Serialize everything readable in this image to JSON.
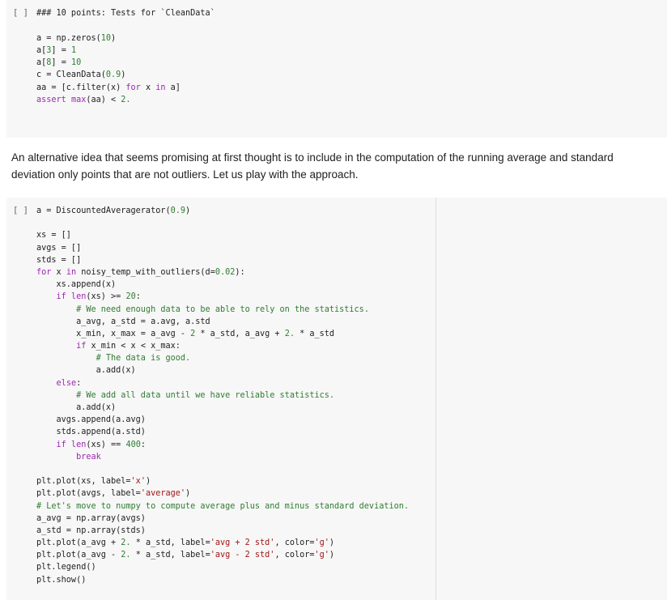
{
  "cell1": {
    "run_label": "[ ]",
    "lines": [
      "### 10 points: Tests for `CleanData`",
      "",
      "a = np.zeros(10)",
      "a[3] = 1",
      "a[8] = 10",
      "c = CleanData(0.9)",
      "aa = [c.filter(x) for x in a]",
      "assert max(aa) < 2."
    ]
  },
  "markdown": {
    "text": "An alternative idea that seems promising at first thought is to include in the computation of the running average and standard deviation only points that are not outliers. Let us play with the approach."
  },
  "cell2": {
    "run_label": "[ ]",
    "lines": [
      "a = DiscountedAveragerator(0.9)",
      "",
      "xs = []",
      "avgs = []",
      "stds = []",
      "for x in noisy_temp_with_outliers(d=0.02):",
      "    xs.append(x)",
      "    if len(xs) >= 20:",
      "        # We need enough data to be able to rely on the statistics.",
      "        a_avg, a_std = a.avg, a.std",
      "        x_min, x_max = a_avg - 2 * a_std, a_avg + 2. * a_std",
      "        if x_min < x < x_max:",
      "            # The data is good.",
      "            a.add(x)",
      "    else:",
      "        # We add all data until we have reliable statistics.",
      "        a.add(x)",
      "    avgs.append(a.avg)",
      "    stds.append(a.std)",
      "    if len(xs) == 400:",
      "        break",
      "",
      "plt.plot(xs, label='x')",
      "plt.plot(avgs, label='average')",
      "# Let's move to numpy to compute average plus and minus standard deviation.",
      "a_avg = np.array(avgs)",
      "a_std = np.array(stds)",
      "plt.plot(a_avg + 2. * a_std, label='avg + 2 std', color='g')",
      "plt.plot(a_avg - 2. * a_std, label='avg - 2 std', color='g')",
      "plt.legend()",
      "plt.show()"
    ]
  }
}
